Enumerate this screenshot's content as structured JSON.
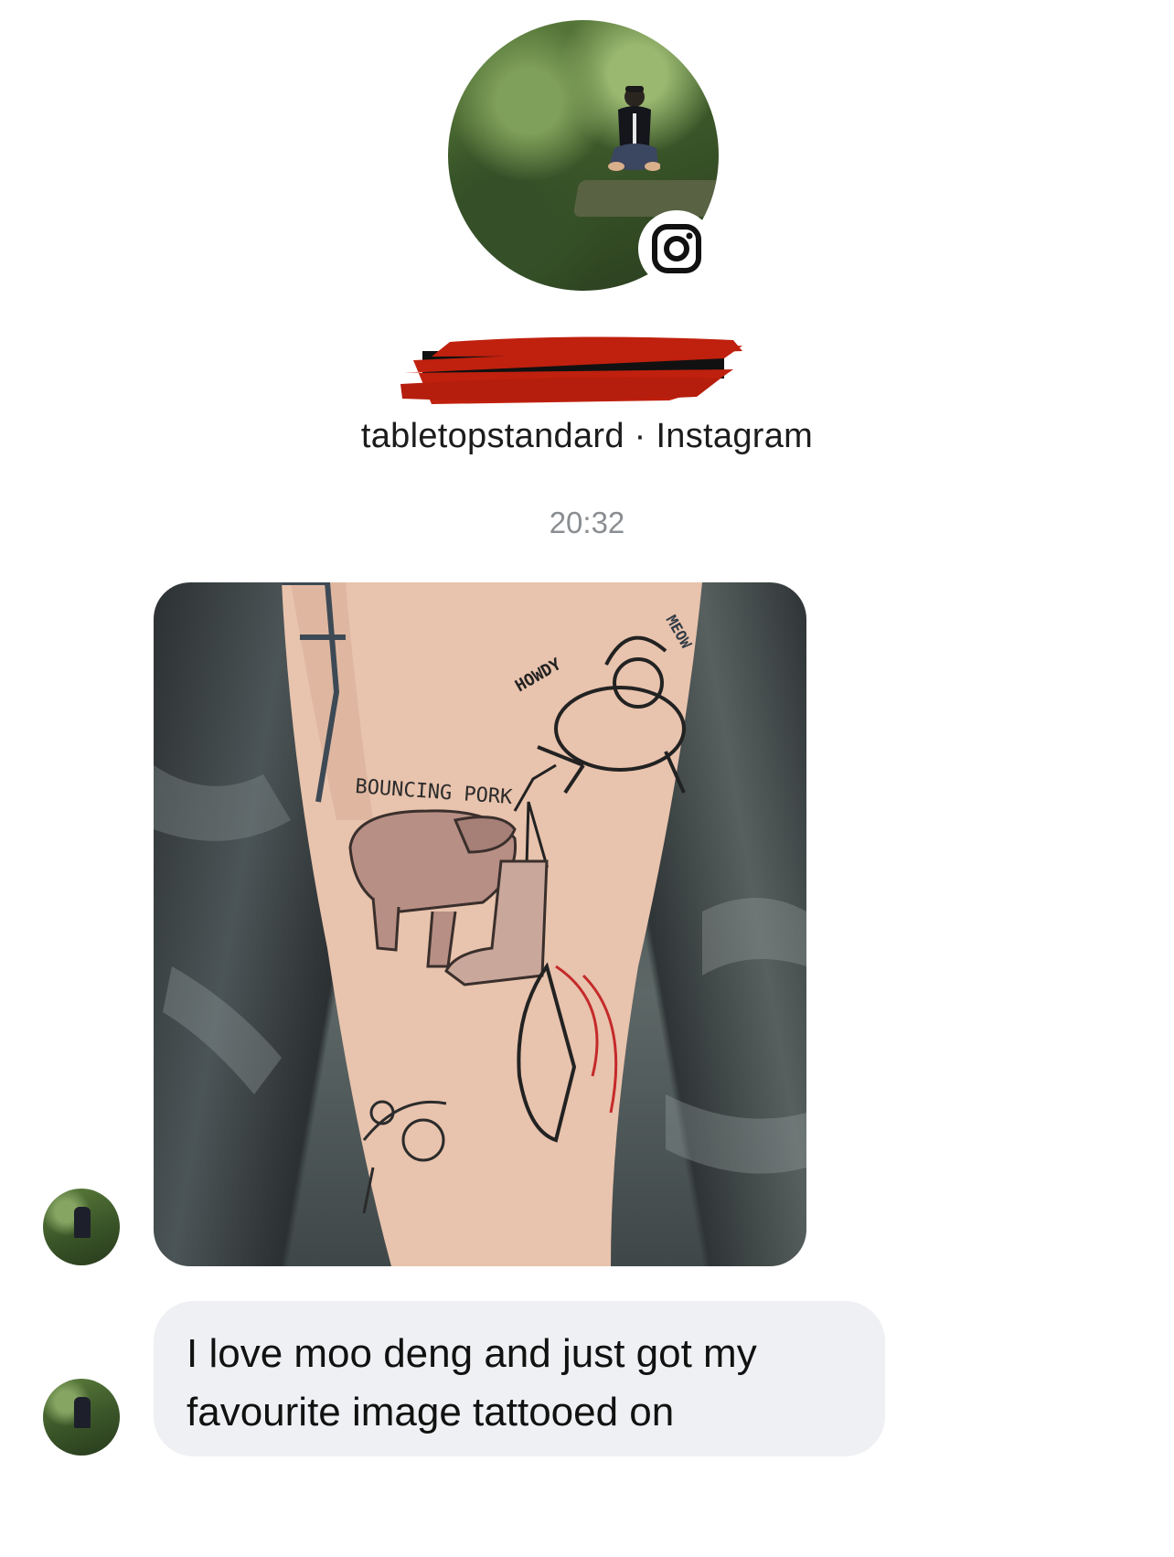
{
  "header": {
    "username": "tabletopstandard",
    "separator": " · ",
    "platform": "Instagram"
  },
  "timestamp": "20:32",
  "photo": {
    "tattoo_texts": [
      "BOUNCING PORK",
      "HOWDY",
      "MEOW"
    ]
  },
  "message": {
    "text": "I love moo deng and just got my favourite image tattooed on"
  },
  "icons": {
    "badge": "instagram-icon"
  },
  "colors": {
    "bubble": "#eff0f3",
    "redaction": "#c0200e",
    "timestamp": "#8a8d91"
  }
}
